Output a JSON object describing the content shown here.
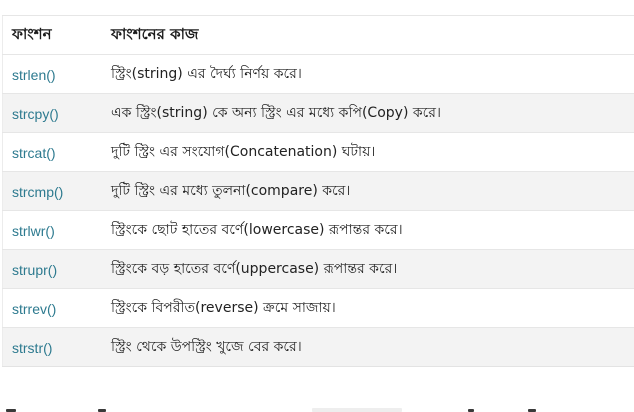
{
  "table": {
    "headers": {
      "function": "ফাংশন",
      "task": "ফাংশনের কাজ"
    },
    "rows": [
      {
        "function": "strlen()",
        "description": "স্ট্রিং(string) এর দৈর্ঘ্য নির্ণয় করে।"
      },
      {
        "function": "strcpy()",
        "description": "এক স্ট্রিং(string) কে অন্য স্ট্রিং এর মধ্যে কপি(Copy) করে।"
      },
      {
        "function": "strcat()",
        "description": "দুটি স্ট্রিং এর সংযোগ(Concatenation) ঘটায়।"
      },
      {
        "function": "strcmp()",
        "description": "দুটি স্ট্রিং এর মধ্যে তুলনা(compare) করে।"
      },
      {
        "function": "strlwr()",
        "description": "স্ট্রিংকে ছোট হাতের বর্ণে(lowercase) রূপান্তর করে।"
      },
      {
        "function": "strupr()",
        "description": "স্ট্রিংকে বড় হাতের বর্ণে(uppercase) রূপান্তর করে।"
      },
      {
        "function": "strrev()",
        "description": "স্ট্রিংকে বিপরীত(reverse) ক্রমে সাজায়।"
      },
      {
        "function": "strstr()",
        "description": "স্ট্রিং থেকে উপস্ট্রিং খুজে বের করে।"
      }
    ]
  },
  "colors": {
    "link": "#2d7a8f",
    "alt_row": "#f3f3f3",
    "border": "#e3e3e3",
    "text": "#222222"
  }
}
